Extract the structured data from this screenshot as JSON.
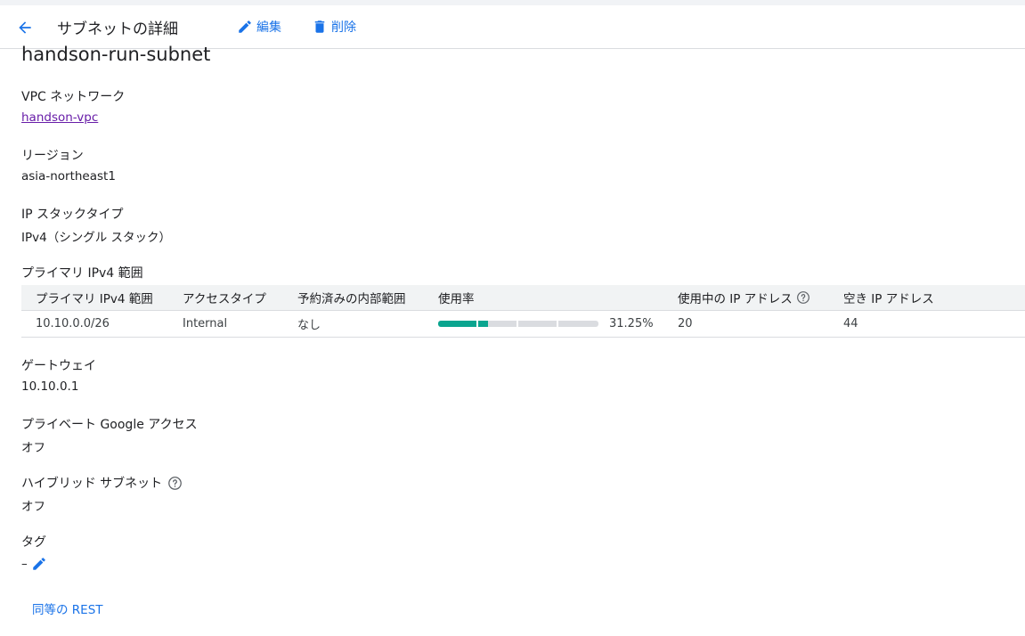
{
  "header": {
    "title": "サブネットの詳細",
    "edit_label": "編集",
    "delete_label": "削除"
  },
  "subnet": {
    "name": "handson-run-subnet"
  },
  "fields": {
    "vpc_label": "VPC ネットワーク",
    "vpc_value": "handson-vpc",
    "region_label": "リージョン",
    "region_value": "asia-northeast1",
    "stack_label": "IP スタックタイプ",
    "stack_value": "IPv4（シングル スタック）",
    "primary_range_label": "プライマリ IPv4 範囲",
    "gateway_label": "ゲートウェイ",
    "gateway_value": "10.10.0.1",
    "pga_label": "プライベート Google アクセス",
    "pga_value": "オフ",
    "hybrid_label": "ハイブリッド サブネット",
    "hybrid_value": "オフ",
    "tags_label": "タグ",
    "tags_value": "–"
  },
  "table": {
    "headers": [
      "プライマリ IPv4 範囲",
      "アクセスタイプ",
      "予約済みの内部範囲",
      "使用率",
      "使用中の IP アドレス",
      "空き IP アドレス"
    ],
    "rows": [
      {
        "range": "10.10.0.0/26",
        "access": "Internal",
        "reserved": "なし",
        "usage_text": "31.25%",
        "usage_fraction": 0.3125,
        "used_ips": "20",
        "free_ips": "44"
      }
    ]
  },
  "footer": {
    "rest_label": "同等の REST"
  },
  "colors": {
    "accent": "#1a73e8",
    "usage_fill": "#0aa58f",
    "visited_link": "#681da8"
  },
  "icons": {
    "back": "arrow-back-icon",
    "edit": "pencil-icon",
    "delete": "trash-icon",
    "help": "help-circle-icon"
  }
}
